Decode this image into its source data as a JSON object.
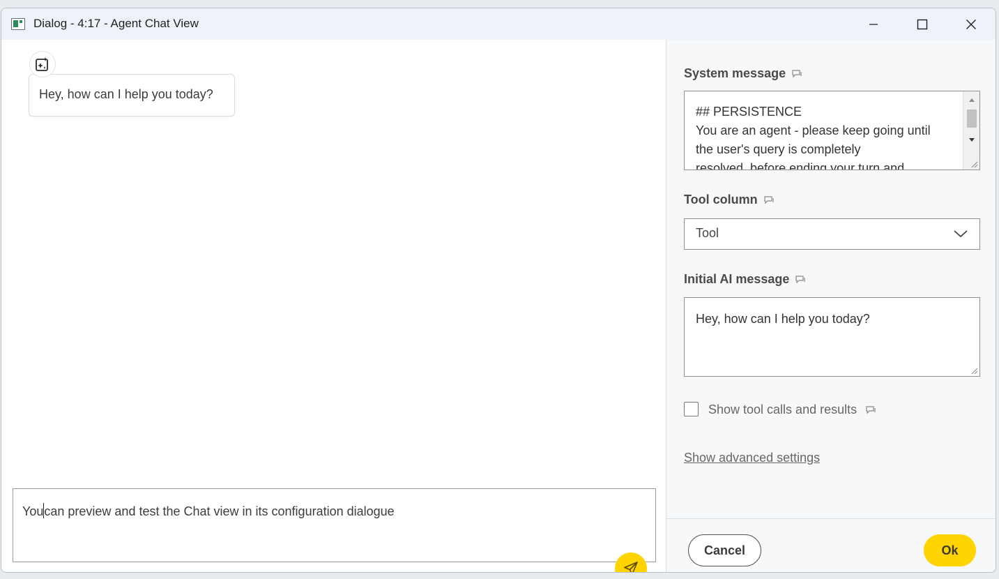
{
  "window": {
    "title": "Dialog - 4:17 - Agent Chat View",
    "controls": [
      "minimize-icon",
      "maximize-icon",
      "close-icon"
    ]
  },
  "chat": {
    "initial_message": "Hey, how can I help you today?",
    "input_value_before_caret": "You",
    "input_value_after_caret": "can preview and test the Chat view in its configuration dialogue",
    "send_icon": "send-icon",
    "avatar_icon": "ai-sparkle-icon"
  },
  "config": {
    "system_message_label": "System message",
    "system_message_lines": [
      "## PERSISTENCE",
      "You are an agent - please keep going until",
      "the user's query is completely",
      "resolved, before ending your turn and"
    ],
    "tool_column_label": "Tool column",
    "tool_column_value": "Tool",
    "initial_ai_message_label": "Initial AI message",
    "initial_ai_message_value": "Hey, how can I help you today?",
    "show_tool_calls_label": "Show tool calls and results",
    "show_tool_calls_checked": false,
    "advanced_link": "Show advanced settings",
    "info_icon": "info-flow-icon"
  },
  "footer": {
    "cancel_label": "Cancel",
    "ok_label": "Ok"
  },
  "colors": {
    "accent": "#ffd400",
    "titlebar": "#eef3fa",
    "config_bg": "#f6f8fa"
  }
}
